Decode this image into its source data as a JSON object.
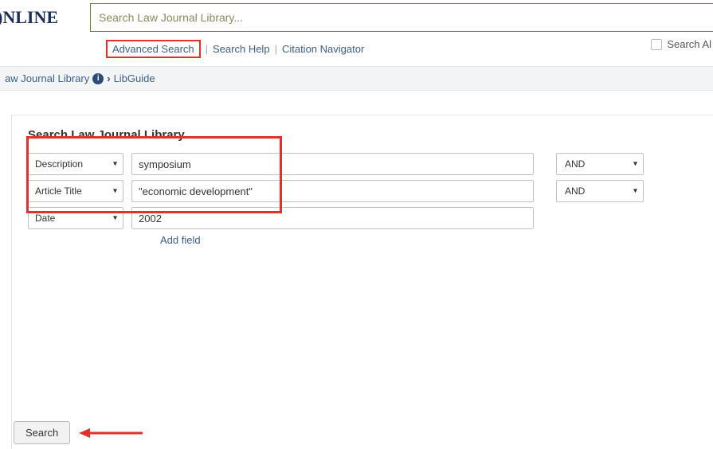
{
  "header": {
    "logo_text": ")NLINE",
    "search_placeholder": "Search Law Journal Library..."
  },
  "subnav": {
    "advanced": "Advanced Search",
    "help": "Search Help",
    "citation": "Citation Navigator",
    "search_all": "Search Al"
  },
  "breadcrumb": {
    "lib": "aw Journal Library",
    "guide": "LibGuide"
  },
  "panel": {
    "title": "Search Law Journal Library",
    "rows": [
      {
        "field": "Description",
        "value": "symposium",
        "bool": "AND"
      },
      {
        "field": "Article Title",
        "value": "\"economic development\"",
        "bool": "AND"
      },
      {
        "field": "Date",
        "value": "2002",
        "bool": ""
      }
    ],
    "add_field": "Add field",
    "search_btn": "Search"
  }
}
